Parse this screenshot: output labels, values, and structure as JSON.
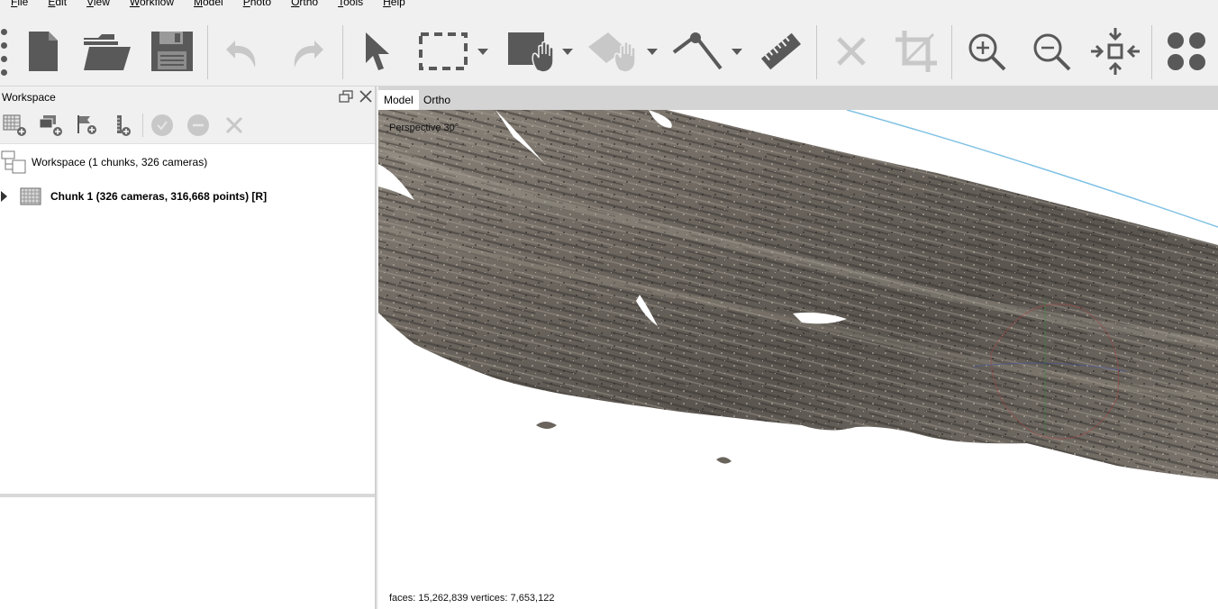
{
  "menu": [
    {
      "key": "F",
      "rest": "ile"
    },
    {
      "key": "E",
      "rest": "dit"
    },
    {
      "key": "V",
      "rest": "iew"
    },
    {
      "key": "W",
      "rest": "orkflow"
    },
    {
      "key": "M",
      "rest": "odel"
    },
    {
      "key": "P",
      "rest": "hoto"
    },
    {
      "key": "O",
      "rest": "rtho"
    },
    {
      "key": "T",
      "rest": "ools"
    },
    {
      "key": "H",
      "rest": "elp"
    }
  ],
  "toolbar": {
    "icons": [
      "new-document-icon",
      "open-folder-icon",
      "save-icon",
      "undo-icon",
      "redo-icon",
      "navigation-arrow-icon",
      "rectangle-selection-icon",
      "dropdown-arrow-icon",
      "draw-shape-icon",
      "dropdown-arrow-icon",
      "resize-region-icon",
      "dropdown-arrow-icon",
      "ruler-line-icon",
      "dropdown-arrow-icon",
      "ruler-icon",
      "delete-selection-icon",
      "crop-selection-icon",
      "zoom-in-icon",
      "zoom-out-icon",
      "reset-view-icon",
      "more-icon"
    ]
  },
  "workspace": {
    "title": "Workspace",
    "root_label": "Workspace (1 chunks, 326 cameras)",
    "chunk_label": "Chunk 1 (326 cameras, 316,668 points) [R]"
  },
  "view": {
    "tabs": [
      "Model",
      "Ortho"
    ],
    "active_tab": "Model",
    "perspective_label": "Perspective 30°",
    "stats": "faces: 15,262,839 vertices: 7,653,122"
  },
  "colors": {
    "background": "#f0f0f0",
    "icon_dark": "#595959",
    "icon_disabled": "#c8c8c8",
    "tab_bar": "#d4d4d4"
  }
}
